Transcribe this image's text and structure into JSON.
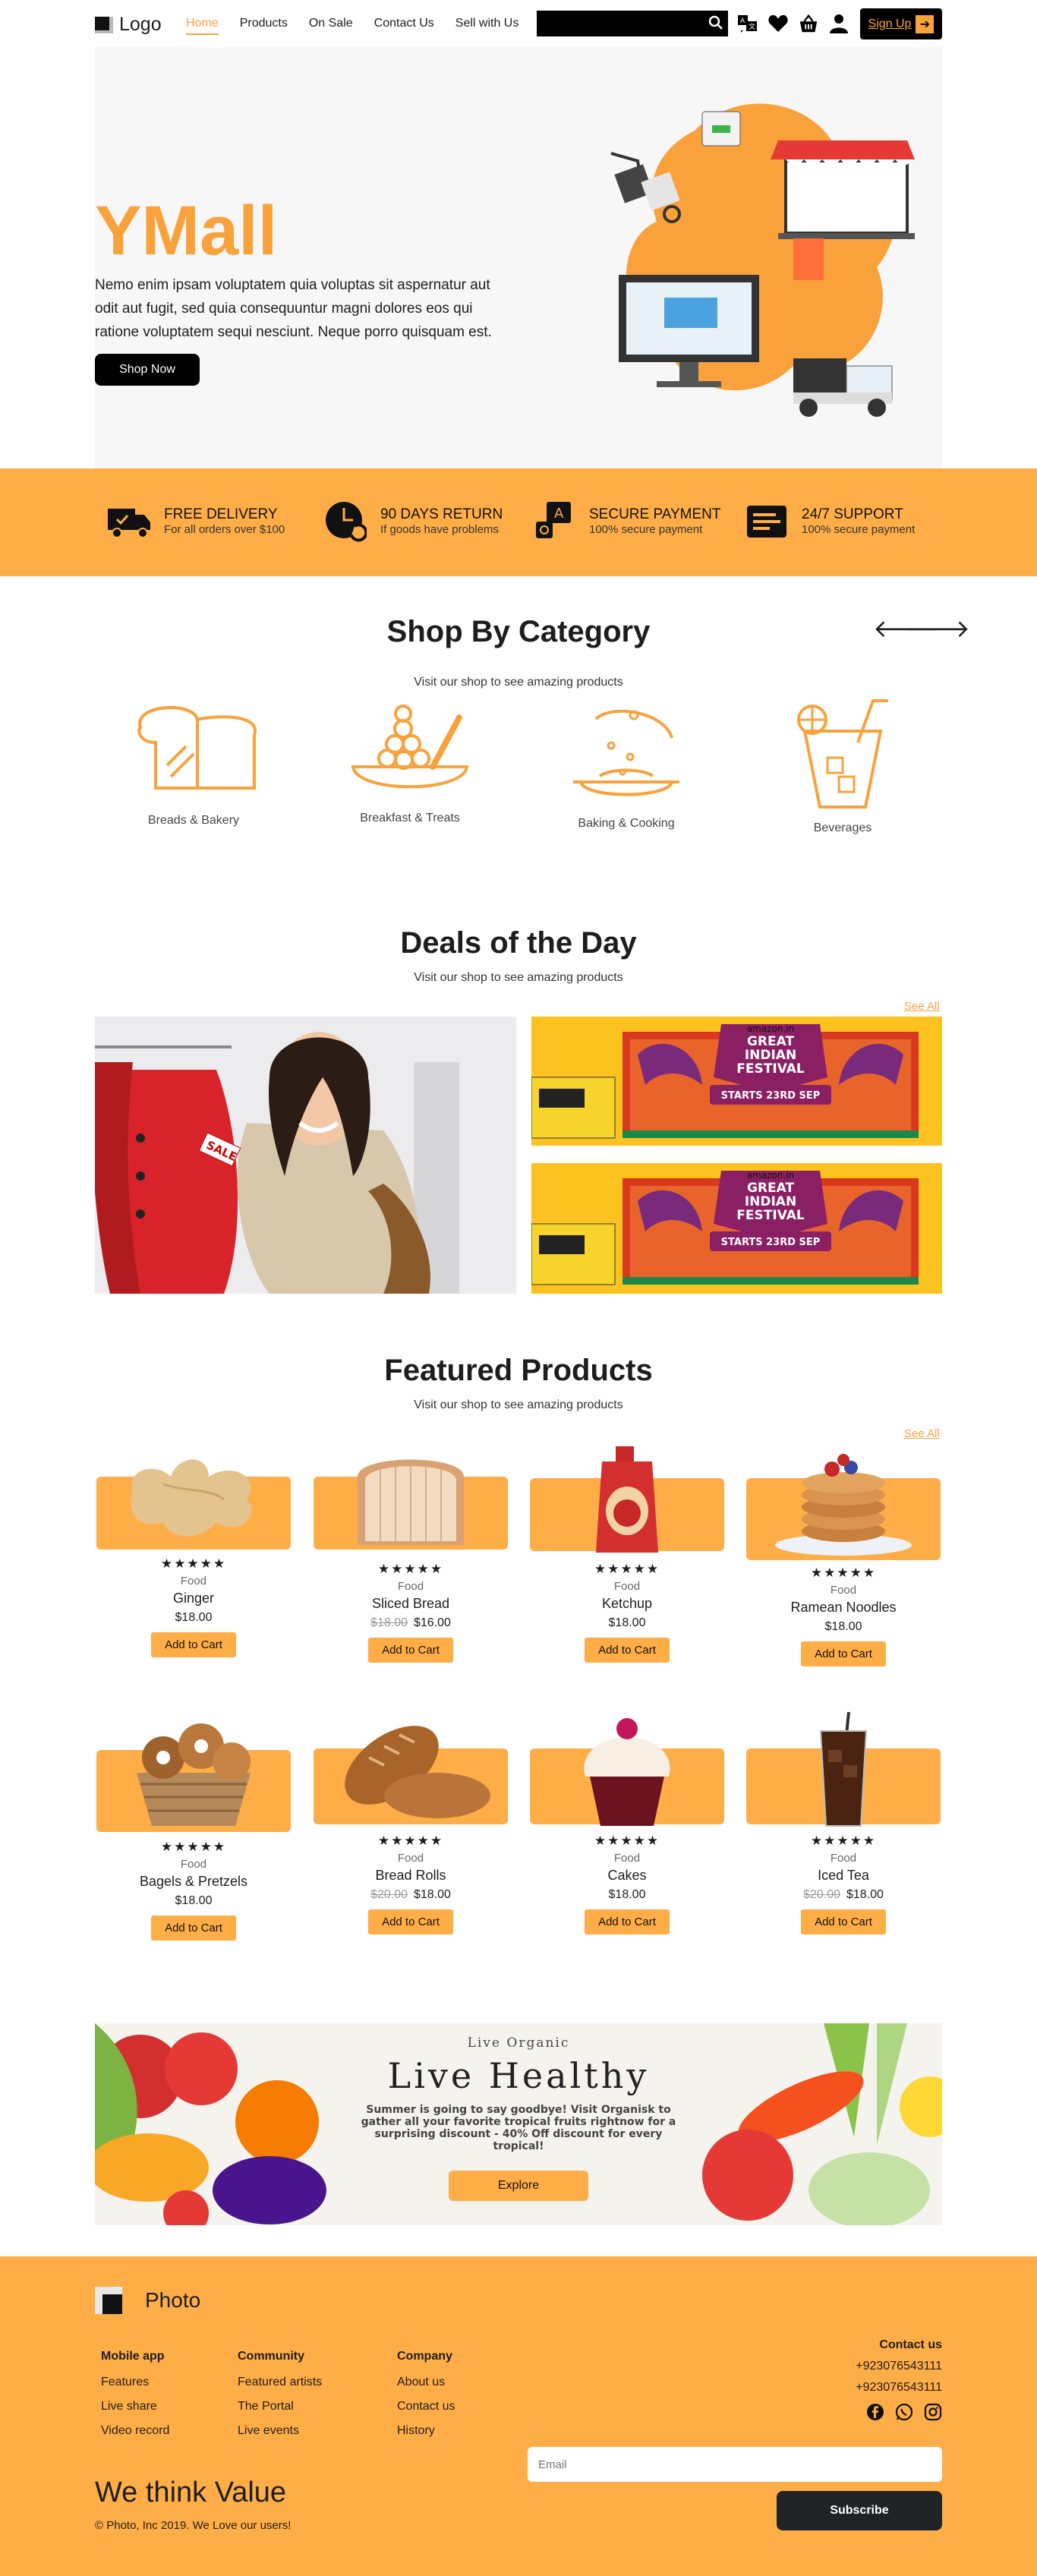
{
  "nav": {
    "logo": "Logo",
    "links": [
      "Home",
      "Products",
      "On Sale",
      "Contact Us",
      "Sell with Us"
    ],
    "search_placeholder": "",
    "signup": "Sign Up"
  },
  "hero": {
    "title": "YMall",
    "text": "Nemo enim ipsam voluptatem quia voluptas sit aspernatur aut odit aut fugit, sed quia consequuntur magni dolores eos qui ratione voluptatem sequi nesciunt. Neque porro quisquam est.",
    "button": "Shop Now"
  },
  "features": [
    {
      "title": "FREE DELIVERY",
      "sub": "For all orders over $100",
      "icon": "truck-icon"
    },
    {
      "title": "90 DAYS RETURN",
      "sub": "If goods have problems",
      "icon": "return-clock-icon"
    },
    {
      "title": "SECURE PAYMENT",
      "sub": "100% secure payment",
      "icon": "secure-payment-icon"
    },
    {
      "title": "24/7 SUPPORT",
      "sub": "100% secure payment",
      "icon": "support-icon"
    }
  ],
  "categories": {
    "title": "Shop By Category",
    "subtitle": "Visit our shop to see amazing products",
    "items": [
      "Breads & Bakery",
      "Breakfast & Treats",
      "Baking & Cooking",
      "Beverages"
    ]
  },
  "deals": {
    "title": "Deals of the Day",
    "subtitle": "Visit our shop to see amazing products",
    "see_all": "See All",
    "sale_tag": "SALE",
    "banner_brand": "amazon.in",
    "banner_line1": "GREAT",
    "banner_line2": "INDIAN",
    "banner_line3": "FESTIVAL",
    "banner_starts": "STARTS 23RD SEP"
  },
  "featured": {
    "title": "Featured Products",
    "subtitle": "Visit our shop to see amazing products",
    "see_all": "See All",
    "stars": "★★★★★",
    "cart_label": "Add to Cart",
    "products": [
      {
        "cat": "Food",
        "name": "Ginger",
        "old": "",
        "price": "$18.00"
      },
      {
        "cat": "Food",
        "name": "Sliced Bread",
        "old": "$18.00",
        "price": "$16.00"
      },
      {
        "cat": "Food",
        "name": "Ketchup",
        "old": "",
        "price": "$18.00"
      },
      {
        "cat": "Food",
        "name": "Ramean Noodles",
        "old": "",
        "price": "$18.00"
      },
      {
        "cat": "Food",
        "name": "Bagels & Pretzels",
        "old": "",
        "price": "$18.00"
      },
      {
        "cat": "Food",
        "name": "Bread Rolls",
        "old": "$20.00",
        "price": "$18.00"
      },
      {
        "cat": "Food",
        "name": "Cakes",
        "old": "",
        "price": "$18.00"
      },
      {
        "cat": "Food",
        "name": "Iced Tea",
        "old": "$20.00",
        "price": "$18.00"
      }
    ]
  },
  "banner": {
    "kicker": "Live Organic",
    "title": "Live Healthy",
    "text": "Summer is going to say goodbye! Visit Organisk to gather all your favorite tropical fruits rightnow for a surprising discount - 40% Off discount for every tropical!",
    "button": "Explore"
  },
  "footer": {
    "brand": "Photo",
    "cols": [
      {
        "title": "Mobile app",
        "items": [
          "Features",
          "Live share",
          "Video record"
        ]
      },
      {
        "title": "Community",
        "items": [
          "Featured artists",
          "The Portal",
          "Live events"
        ]
      },
      {
        "title": "Company",
        "items": [
          "About us",
          "Contact us",
          "History"
        ]
      }
    ],
    "contact_title": "Contact us",
    "phones": [
      "+923076543111",
      "+923076543111"
    ],
    "tagline": "We think Value",
    "copyright": "© Photo, Inc 2019. We Love our users!",
    "email_placeholder": "Email",
    "subscribe": "Subscribe"
  },
  "colors": {
    "accent": "#ffad47",
    "brand_text": "#f9a23c",
    "dark": "#000000"
  }
}
